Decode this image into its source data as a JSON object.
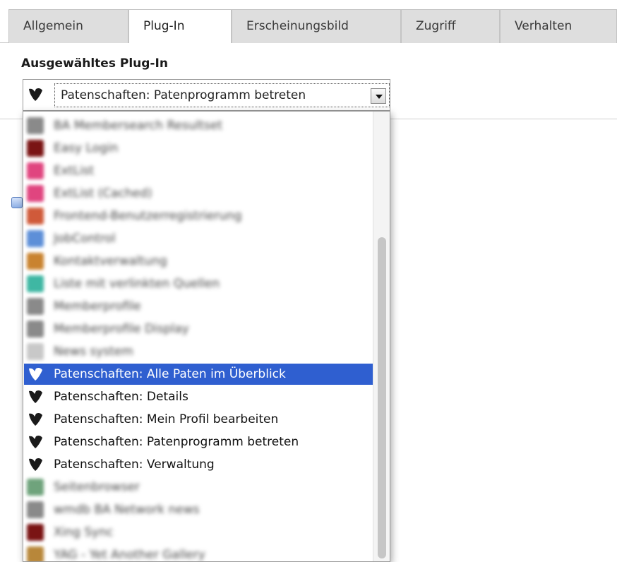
{
  "tabs": [
    {
      "label": "Allgemein",
      "active": false
    },
    {
      "label": "Plug-In",
      "active": true
    },
    {
      "label": "Erscheinungsbild",
      "active": false
    },
    {
      "label": "Zugriff",
      "active": false
    },
    {
      "label": "Verhalten",
      "active": false
    }
  ],
  "panel": {
    "title": "Ausgewähltes Plug-In",
    "select": {
      "value": "Patenschaften: Patenprogramm betreten",
      "icon": "typo3-icon"
    }
  },
  "dropdown": {
    "options": [
      {
        "label": "BA Membersearch Resultset",
        "icon": "plugin-icon",
        "color": "#8a8a8a",
        "blurred": true
      },
      {
        "label": "Easy Login",
        "icon": "plugin-icon",
        "color": "#7a1414",
        "blurred": true
      },
      {
        "label": "ExtList",
        "icon": "plugin-icon",
        "color": "#e0457f",
        "blurred": true
      },
      {
        "label": "ExtList (Cached)",
        "icon": "plugin-icon",
        "color": "#e0457f",
        "blurred": true
      },
      {
        "label": "Frontend-Benutzerregistrierung",
        "icon": "plugin-icon",
        "color": "#d05a3a",
        "blurred": true
      },
      {
        "label": "JobControl",
        "icon": "plugin-icon",
        "color": "#5d8fd8",
        "blurred": true
      },
      {
        "label": "Kontaktverwaltung",
        "icon": "plugin-icon",
        "color": "#c9832f",
        "blurred": true
      },
      {
        "label": "Liste mit verlinkten Quellen",
        "icon": "plugin-icon",
        "color": "#3fb7a3",
        "blurred": true
      },
      {
        "label": "Memberprofile",
        "icon": "plugin-icon",
        "color": "#8a8a8a",
        "blurred": true
      },
      {
        "label": "Memberprofile Display",
        "icon": "plugin-icon",
        "color": "#8a8a8a",
        "blurred": true
      },
      {
        "label": "News system",
        "icon": "plugin-icon",
        "color": "#c8c8c8",
        "blurred": true
      },
      {
        "label": "Patenschaften: Alle Paten im Überblick",
        "icon": "typo3-icon",
        "selected": true,
        "blurred": false
      },
      {
        "label": "Patenschaften: Details",
        "icon": "typo3-icon",
        "blurred": false
      },
      {
        "label": "Patenschaften: Mein Profil bearbeiten",
        "icon": "typo3-icon",
        "blurred": false
      },
      {
        "label": "Patenschaften: Patenprogramm betreten",
        "icon": "typo3-icon",
        "blurred": false
      },
      {
        "label": "Patenschaften: Verwaltung",
        "icon": "typo3-icon",
        "blurred": false
      },
      {
        "label": "Seitenbrowser",
        "icon": "plugin-icon",
        "color": "#6fa37c",
        "blurred": true
      },
      {
        "label": "wmdb BA Network news",
        "icon": "plugin-icon",
        "color": "#8a8a8a",
        "blurred": true
      },
      {
        "label": "Xing Sync",
        "icon": "plugin-icon",
        "color": "#7a1414",
        "blurred": true
      },
      {
        "label": "YAG - Yet Another Gallery",
        "icon": "plugin-icon",
        "color": "#b8873a",
        "blurred": true
      }
    ]
  },
  "colors": {
    "selection": "#2f5fd0",
    "tab_inactive": "#dedede"
  }
}
